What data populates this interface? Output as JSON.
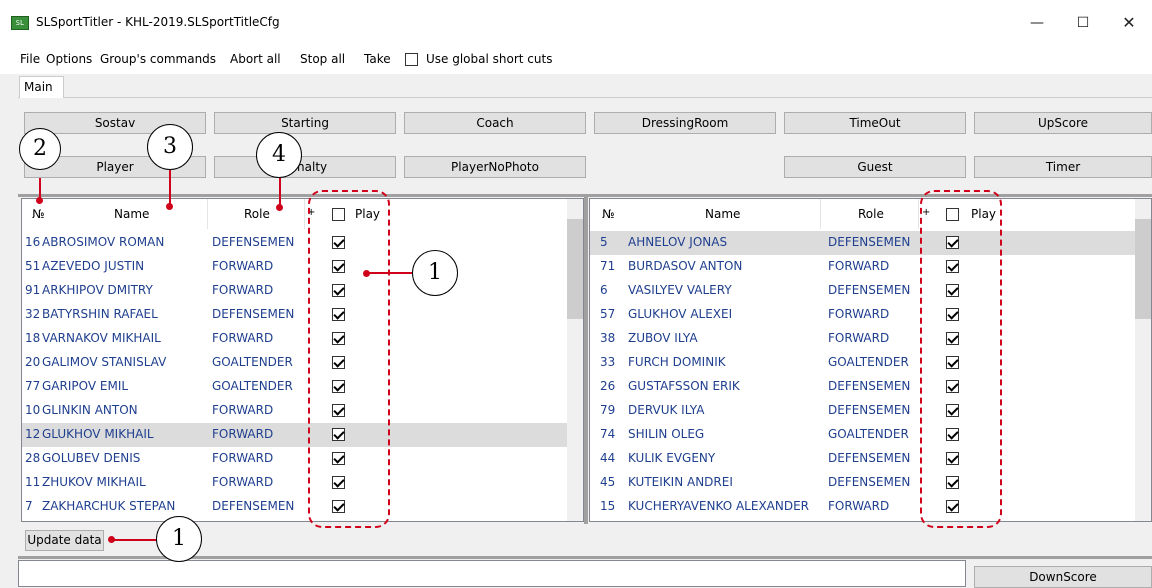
{
  "window": {
    "title": "SLSportTitler - KHL-2019.SLSportTitleCfg",
    "icon": "app-icon",
    "controls": [
      "minimize-icon",
      "maximize-icon",
      "close-icon"
    ]
  },
  "menu": {
    "items": [
      "File",
      "Options",
      "Group's commands",
      "Abort all",
      "Stop all",
      "Take"
    ],
    "global_shortcuts_label": "Use global short cuts",
    "global_shortcuts_checked": false
  },
  "tabs": [
    "Main"
  ],
  "buttons": {
    "row1": [
      "Sostav",
      "Starting",
      "Coach",
      "DressingRoom",
      "TimeOut",
      "UpScore"
    ],
    "row2": [
      "Player",
      "Penalty",
      "PlayerNoPhoto",
      "Guest",
      "Timer"
    ],
    "update": "Update data",
    "downscore": "DownScore"
  },
  "columns": {
    "num": "№",
    "name": "Name",
    "role": "Role",
    "plus": "+",
    "play": "Play"
  },
  "left_team": [
    {
      "num": "16",
      "name": "ABROSIMOV ROMAN",
      "role": "DEFENSEMEN",
      "play": true
    },
    {
      "num": "51",
      "name": "AZEVEDO JUSTIN",
      "role": "FORWARD",
      "play": true
    },
    {
      "num": "91",
      "name": "ARKHIPOV DMITRY",
      "role": "FORWARD",
      "play": true
    },
    {
      "num": "32",
      "name": "BATYRSHIN RAFAEL",
      "role": "DEFENSEMEN",
      "play": true
    },
    {
      "num": "18",
      "name": "VARNAKOV MIKHAIL",
      "role": "FORWARD",
      "play": true
    },
    {
      "num": "20",
      "name": "GALIMOV STANISLAV",
      "role": "GOALTENDER",
      "play": true
    },
    {
      "num": "77",
      "name": "GARIPOV EMIL",
      "role": "GOALTENDER",
      "play": true
    },
    {
      "num": "10",
      "name": "GLINKIN ANTON",
      "role": "FORWARD",
      "play": true
    },
    {
      "num": "12",
      "name": "GLUKHOV MIKHAIL",
      "role": "FORWARD",
      "play": true,
      "selected": true
    },
    {
      "num": "28",
      "name": "GOLUBEV DENIS",
      "role": "FORWARD",
      "play": true
    },
    {
      "num": "11",
      "name": "ZHUKOV MIKHAIL",
      "role": "FORWARD",
      "play": true
    },
    {
      "num": "7",
      "name": "ZAKHARCHUK STEPAN",
      "role": "DEFENSEMEN",
      "play": true
    }
  ],
  "right_team": [
    {
      "num": "5",
      "name": "AHNELOV JONAS",
      "role": "DEFENSEMEN",
      "play": true,
      "selected": true
    },
    {
      "num": "71",
      "name": "BURDASOV ANTON",
      "role": "FORWARD",
      "play": true
    },
    {
      "num": "6",
      "name": "VASILYEV VALERY",
      "role": "DEFENSEMEN",
      "play": true
    },
    {
      "num": "57",
      "name": "GLUKHOV ALEXEI",
      "role": "FORWARD",
      "play": true
    },
    {
      "num": "38",
      "name": "ZUBOV ILYA",
      "role": "FORWARD",
      "play": true
    },
    {
      "num": "33",
      "name": "FURCH DOMINIK",
      "role": "GOALTENDER",
      "play": true
    },
    {
      "num": "26",
      "name": "GUSTAFSSON ERIK",
      "role": "DEFENSEMEN",
      "play": true
    },
    {
      "num": "79",
      "name": "DERVUK ILYA",
      "role": "DEFENSEMEN",
      "play": true
    },
    {
      "num": "74",
      "name": "SHILIN OLEG",
      "role": "GOALTENDER",
      "play": true
    },
    {
      "num": "44",
      "name": "KULIK EVGENY",
      "role": "DEFENSEMEN",
      "play": true
    },
    {
      "num": "45",
      "name": "KUTEIKIN ANDREI",
      "role": "DEFENSEMEN",
      "play": true
    },
    {
      "num": "15",
      "name": "KUCHERYAVENKO ALEXANDER",
      "role": "FORWARD",
      "play": true
    }
  ],
  "callouts": [
    "1",
    "2",
    "3",
    "4",
    "1"
  ],
  "colors": {
    "accent_red": "#d0021b",
    "cell_text": "#1f3f8f"
  }
}
